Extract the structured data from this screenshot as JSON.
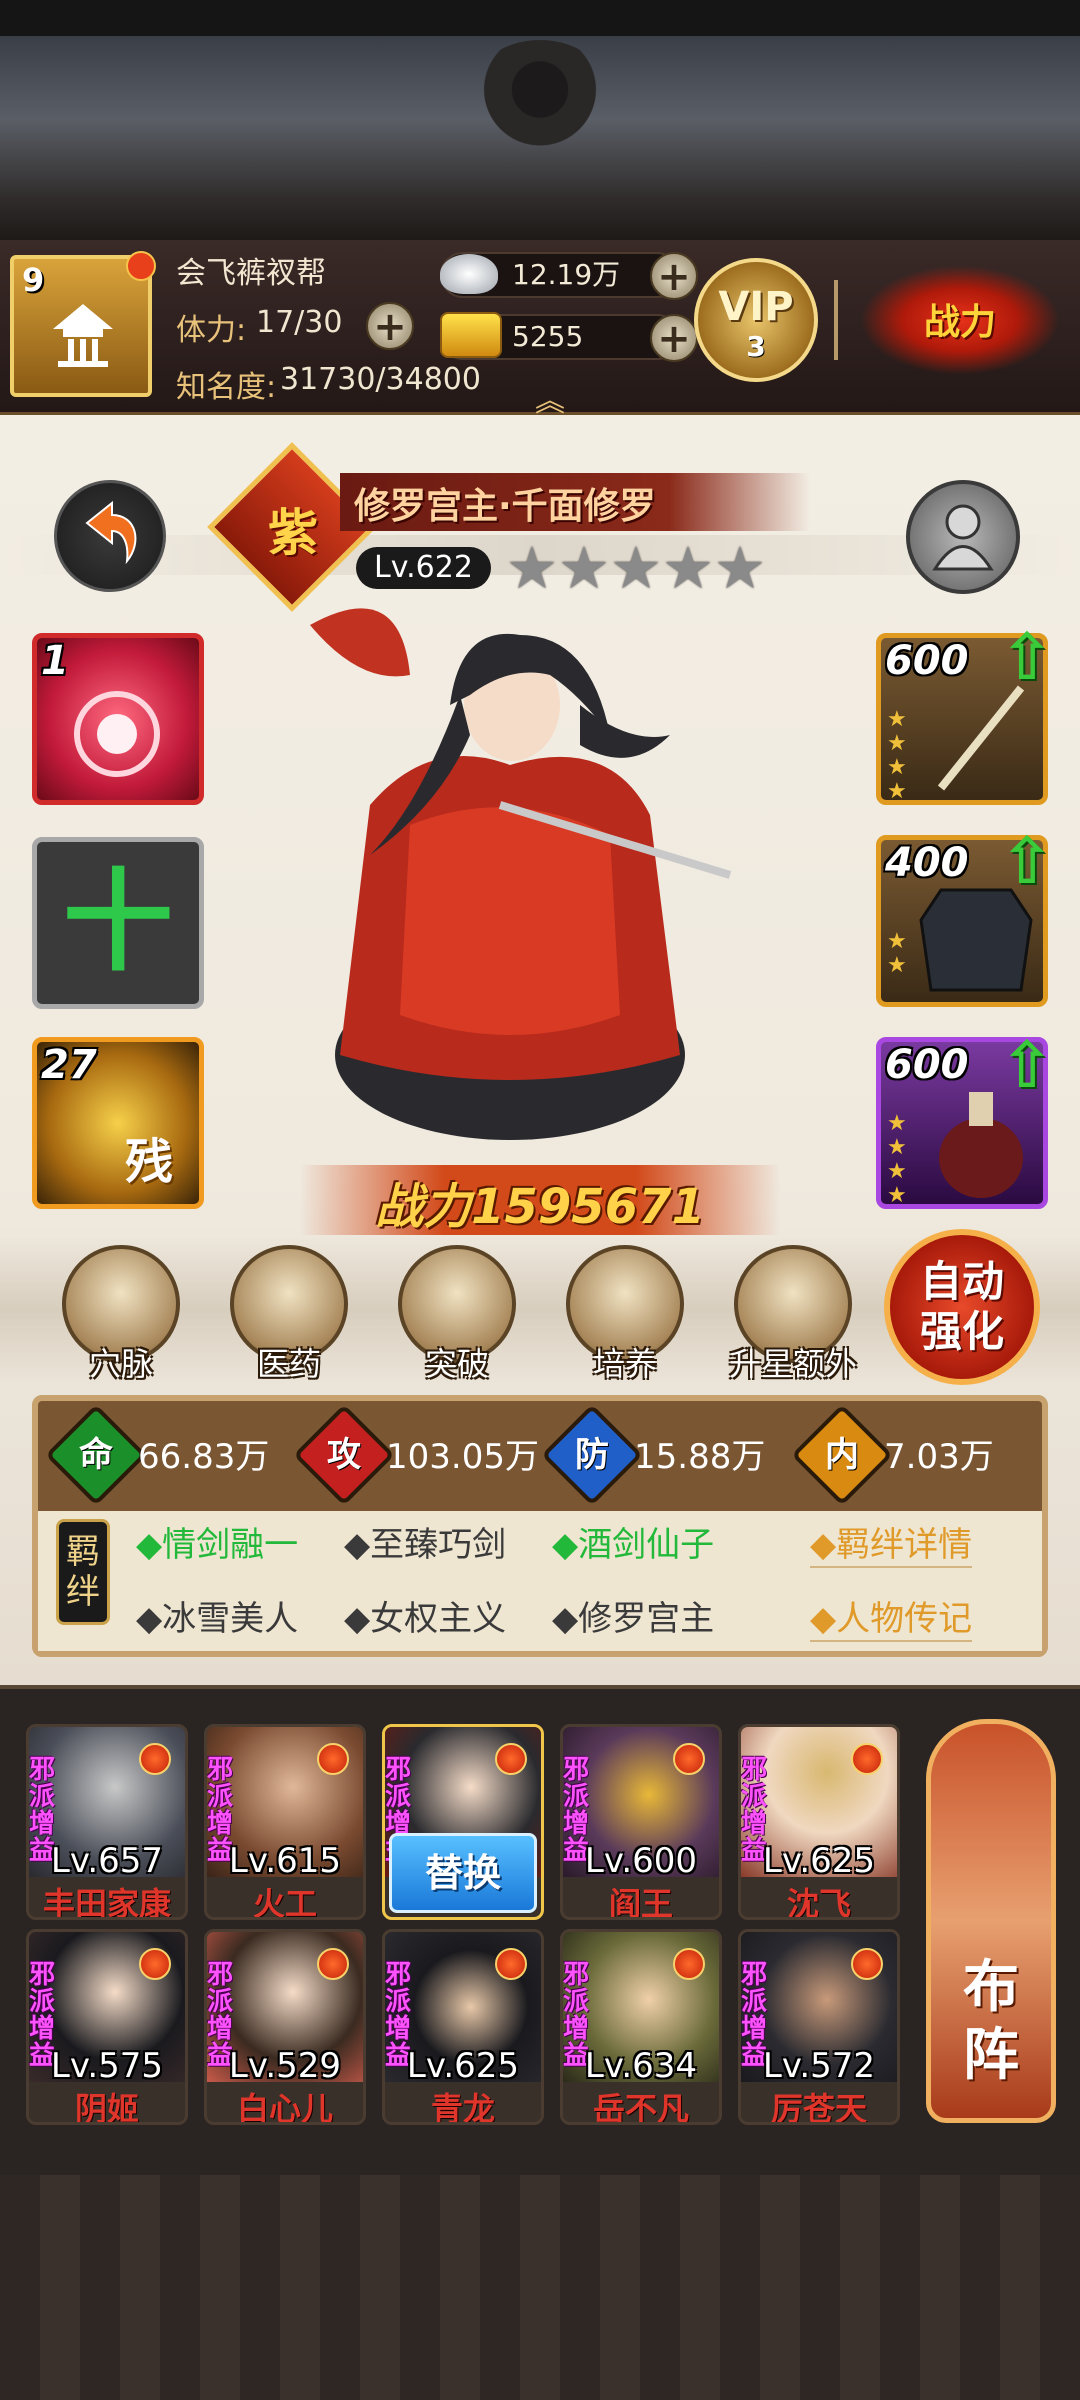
{
  "player": {
    "level": "9",
    "name": "会飞裤衩帮",
    "stamina_label": "体力:",
    "stamina": "17/30",
    "fame_label": "知名度:",
    "fame": "31730/34800"
  },
  "currency": {
    "silver": "12.19万",
    "gold": "5255",
    "plus": "+"
  },
  "vip": {
    "label": "VIP",
    "level": "3"
  },
  "combat_badge": "战力",
  "hero": {
    "name": "修罗宫主·千面修罗",
    "rarity": "紫",
    "level": "Lv.622",
    "stars": [
      "★",
      "★",
      "★",
      "★",
      "★"
    ],
    "power": "战力1595671"
  },
  "skills": [
    {
      "count": "1"
    },
    {
      "symbol": "十"
    },
    {
      "count": "27",
      "label": "残"
    }
  ],
  "equipment": [
    {
      "level": "600",
      "stars": 4,
      "arrow": "⇧"
    },
    {
      "level": "400",
      "stars": 2,
      "arrow": "⇧"
    },
    {
      "level": "600",
      "stars": 4,
      "arrow": "⇧"
    }
  ],
  "actions": [
    {
      "label": "穴脉"
    },
    {
      "label": "医药"
    },
    {
      "label": "突破"
    },
    {
      "label": "培养"
    },
    {
      "label": "升星额外"
    }
  ],
  "auto_enhance": "自动强化",
  "stats": [
    {
      "icon": "命",
      "value": "66.83万",
      "color": "#1a8f2a"
    },
    {
      "icon": "攻",
      "value": "103.05万",
      "color": "#c42020"
    },
    {
      "icon": "防",
      "value": "15.88万",
      "color": "#1f5fc7"
    },
    {
      "icon": "内",
      "value": "7.03万",
      "color": "#d98a10"
    }
  ],
  "bonds": {
    "title": "羁绊",
    "active": [
      "◆情剑融一",
      "◆至臻巧剑",
      "◆酒剑仙子"
    ],
    "inactive": [
      "◆冰雪美人",
      "◆女权主义",
      "◆修罗宫主"
    ],
    "details": "◆羁绊详情",
    "biography": "◆人物传记"
  },
  "team": [
    {
      "tag": "邪派增益",
      "level": "Lv.657",
      "name": "丰田家康"
    },
    {
      "tag": "邪派增益",
      "level": "Lv.615",
      "name": "火工"
    },
    {
      "tag": "邪派增益",
      "level": "",
      "name": "",
      "replace": "替换"
    },
    {
      "tag": "邪派增益",
      "level": "Lv.600",
      "name": "阎王"
    },
    {
      "tag": "邪派增益",
      "level": "Lv.625",
      "name": "沈飞"
    },
    {
      "tag": "邪派增益",
      "level": "Lv.575",
      "name": "阴姬"
    },
    {
      "tag": "邪派增益",
      "level": "Lv.529",
      "name": "白心儿"
    },
    {
      "tag": "邪派增益",
      "level": "Lv.625",
      "name": "青龙"
    },
    {
      "tag": "邪派增益",
      "level": "Lv.634",
      "name": "岳不凡"
    },
    {
      "tag": "邪派增益",
      "level": "Lv.572",
      "name": "厉苍天"
    }
  ],
  "formation": "布阵"
}
